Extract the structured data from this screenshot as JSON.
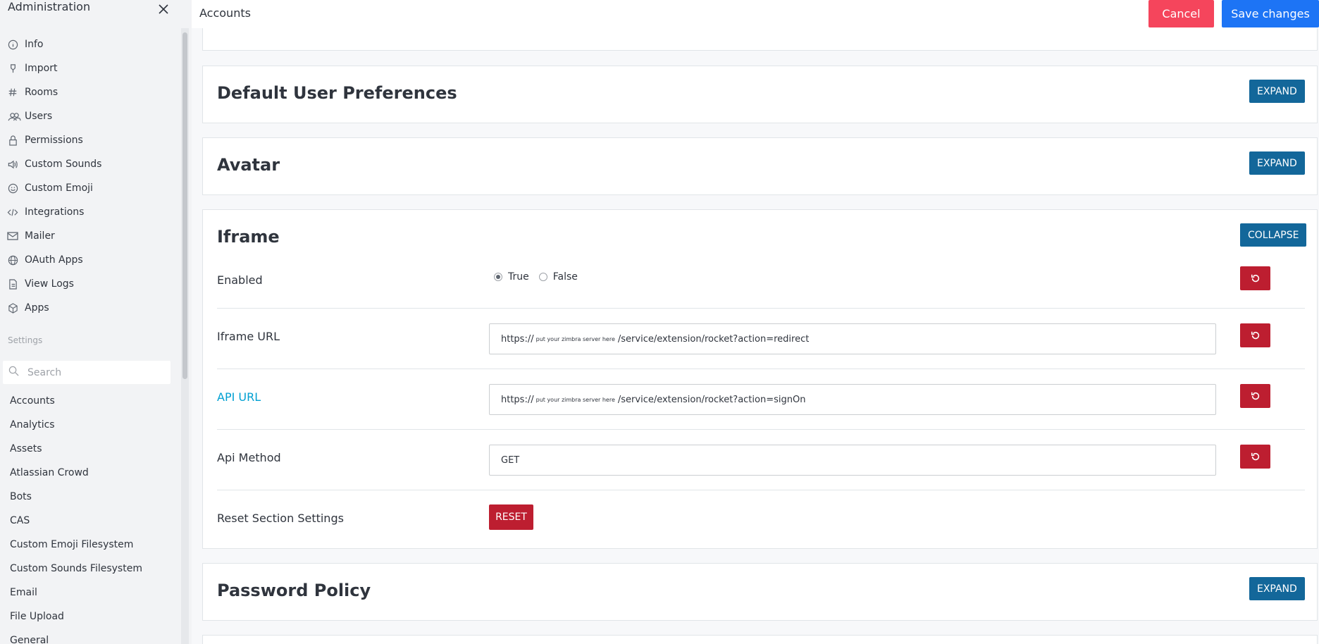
{
  "sidebar": {
    "title": "Administration",
    "nav": [
      {
        "label": "Info",
        "icon": "info-icon"
      },
      {
        "label": "Import",
        "icon": "import-icon"
      },
      {
        "label": "Rooms",
        "icon": "hashtag-icon"
      },
      {
        "label": "Users",
        "icon": "users-icon"
      },
      {
        "label": "Permissions",
        "icon": "lock-icon"
      },
      {
        "label": "Custom Sounds",
        "icon": "speaker-icon"
      },
      {
        "label": "Custom Emoji",
        "icon": "emoji-icon"
      },
      {
        "label": "Integrations",
        "icon": "code-icon"
      },
      {
        "label": "Mailer",
        "icon": "mail-icon"
      },
      {
        "label": "OAuth Apps",
        "icon": "globe-icon"
      },
      {
        "label": "View Logs",
        "icon": "document-icon"
      },
      {
        "label": "Apps",
        "icon": "cube-icon"
      }
    ],
    "settings_label": "Settings",
    "search_placeholder": "Search",
    "settings_items": [
      "Accounts",
      "Analytics",
      "Assets",
      "Atlassian Crowd",
      "Bots",
      "CAS",
      "Custom Emoji Filesystem",
      "Custom Sounds Filesystem",
      "Email",
      "File Upload",
      "General"
    ]
  },
  "header": {
    "title": "Accounts",
    "cancel_label": "Cancel",
    "save_label": "Save changes"
  },
  "sections": {
    "default_prefs": {
      "title": "Default User Preferences",
      "button": "EXPAND"
    },
    "avatar": {
      "title": "Avatar",
      "button": "EXPAND"
    },
    "iframe": {
      "title": "Iframe",
      "button": "COLLAPSE",
      "enabled": {
        "label": "Enabled",
        "true_label": "True",
        "false_label": "False",
        "value": "True"
      },
      "iframe_url": {
        "label": "Iframe URL",
        "prefix": "https://",
        "placeholder_part": "put your zimbra server here",
        "suffix": "/service/extension/rocket?action=redirect"
      },
      "api_url": {
        "label": "API URL",
        "prefix": "https://",
        "placeholder_part": "put your zimbra server here",
        "suffix": "/service/extension/rocket?action=signOn"
      },
      "api_method": {
        "label": "Api Method",
        "value": "GET"
      },
      "reset_section": {
        "label": "Reset Section Settings",
        "button": "RESET"
      }
    },
    "password_policy": {
      "title": "Password Policy",
      "button": "EXPAND"
    }
  }
}
